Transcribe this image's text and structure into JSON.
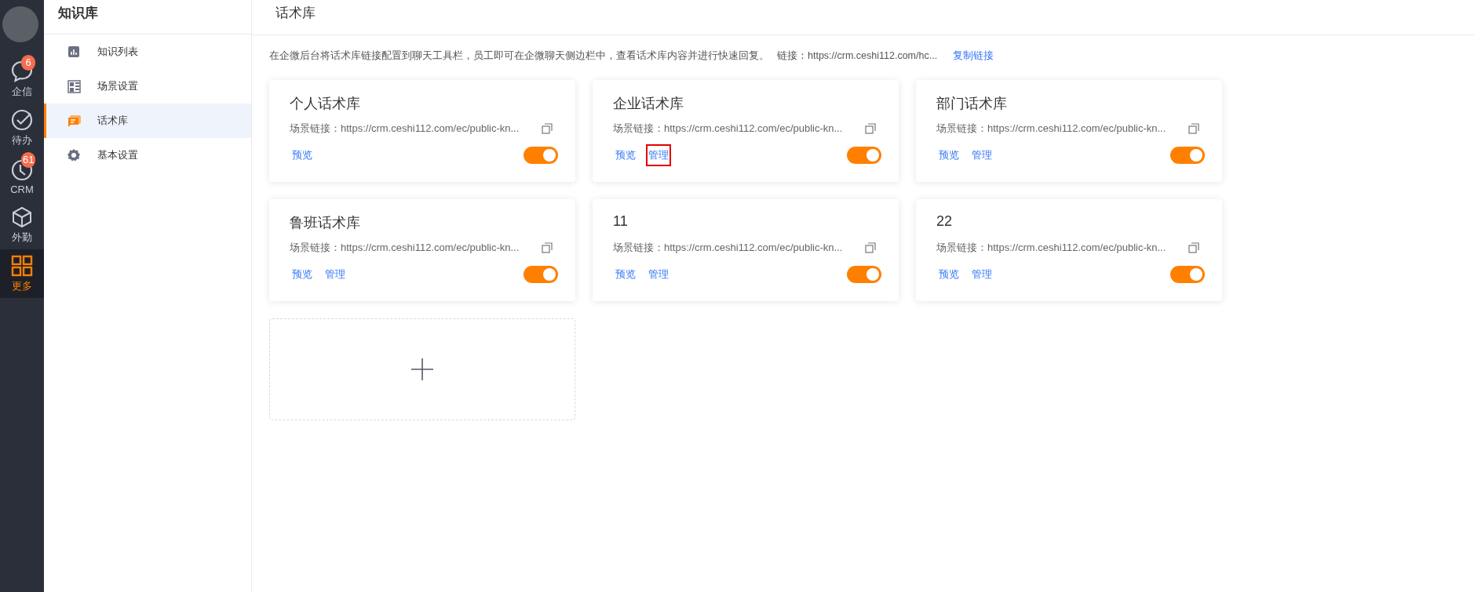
{
  "rail": {
    "items": [
      {
        "label": "企信",
        "badge": "6",
        "selected": false
      },
      {
        "label": "待办",
        "selected": false
      },
      {
        "label": "CRM",
        "badge": "61",
        "selected": false
      },
      {
        "label": "外勤",
        "selected": false
      },
      {
        "label": "更多",
        "selected": true
      }
    ]
  },
  "sidebar": {
    "title": "知识库",
    "items": [
      {
        "label": "知识列表",
        "selected": false
      },
      {
        "label": "场景设置",
        "selected": false
      },
      {
        "label": "话术库",
        "selected": true
      },
      {
        "label": "基本设置",
        "selected": false
      }
    ]
  },
  "header": {
    "title": "话术库"
  },
  "notice": {
    "text": "在企微后台将话术库链接配置到聊天工具栏，员工即可在企微聊天侧边栏中，查看话术库内容并进行快速回复。",
    "link_text": "链接：https://crm.ceshi112.com/hc...",
    "copy_link": "复制链接"
  },
  "cards": [
    {
      "title": "个人话术库",
      "link": "场景链接：https://crm.ceshi112.com/ec/public-kn...",
      "actions": [
        {
          "label": "预览",
          "highlighted": false
        }
      ],
      "on": true
    },
    {
      "title": "企业话术库",
      "link": "场景链接：https://crm.ceshi112.com/ec/public-kn...",
      "actions": [
        {
          "label": "预览",
          "highlighted": false
        },
        {
          "label": "管理",
          "highlighted": true
        }
      ],
      "on": true
    },
    {
      "title": "部门话术库",
      "link": "场景链接：https://crm.ceshi112.com/ec/public-kn...",
      "actions": [
        {
          "label": "预览",
          "highlighted": false
        },
        {
          "label": "管理",
          "highlighted": false
        }
      ],
      "on": true
    },
    {
      "title": "鲁班话术库",
      "link": "场景链接：https://crm.ceshi112.com/ec/public-kn...",
      "actions": [
        {
          "label": "预览",
          "highlighted": false
        },
        {
          "label": "管理",
          "highlighted": false
        }
      ],
      "on": true
    },
    {
      "title": "11",
      "link": "场景链接：https://crm.ceshi112.com/ec/public-kn...",
      "actions": [
        {
          "label": "预览",
          "highlighted": false
        },
        {
          "label": "管理",
          "highlighted": false
        }
      ],
      "on": true
    },
    {
      "title": "22",
      "link": "场景链接：https://crm.ceshi112.com/ec/public-kn...",
      "actions": [
        {
          "label": "预览",
          "highlighted": false
        },
        {
          "label": "管理",
          "highlighted": false
        }
      ],
      "on": true
    }
  ]
}
